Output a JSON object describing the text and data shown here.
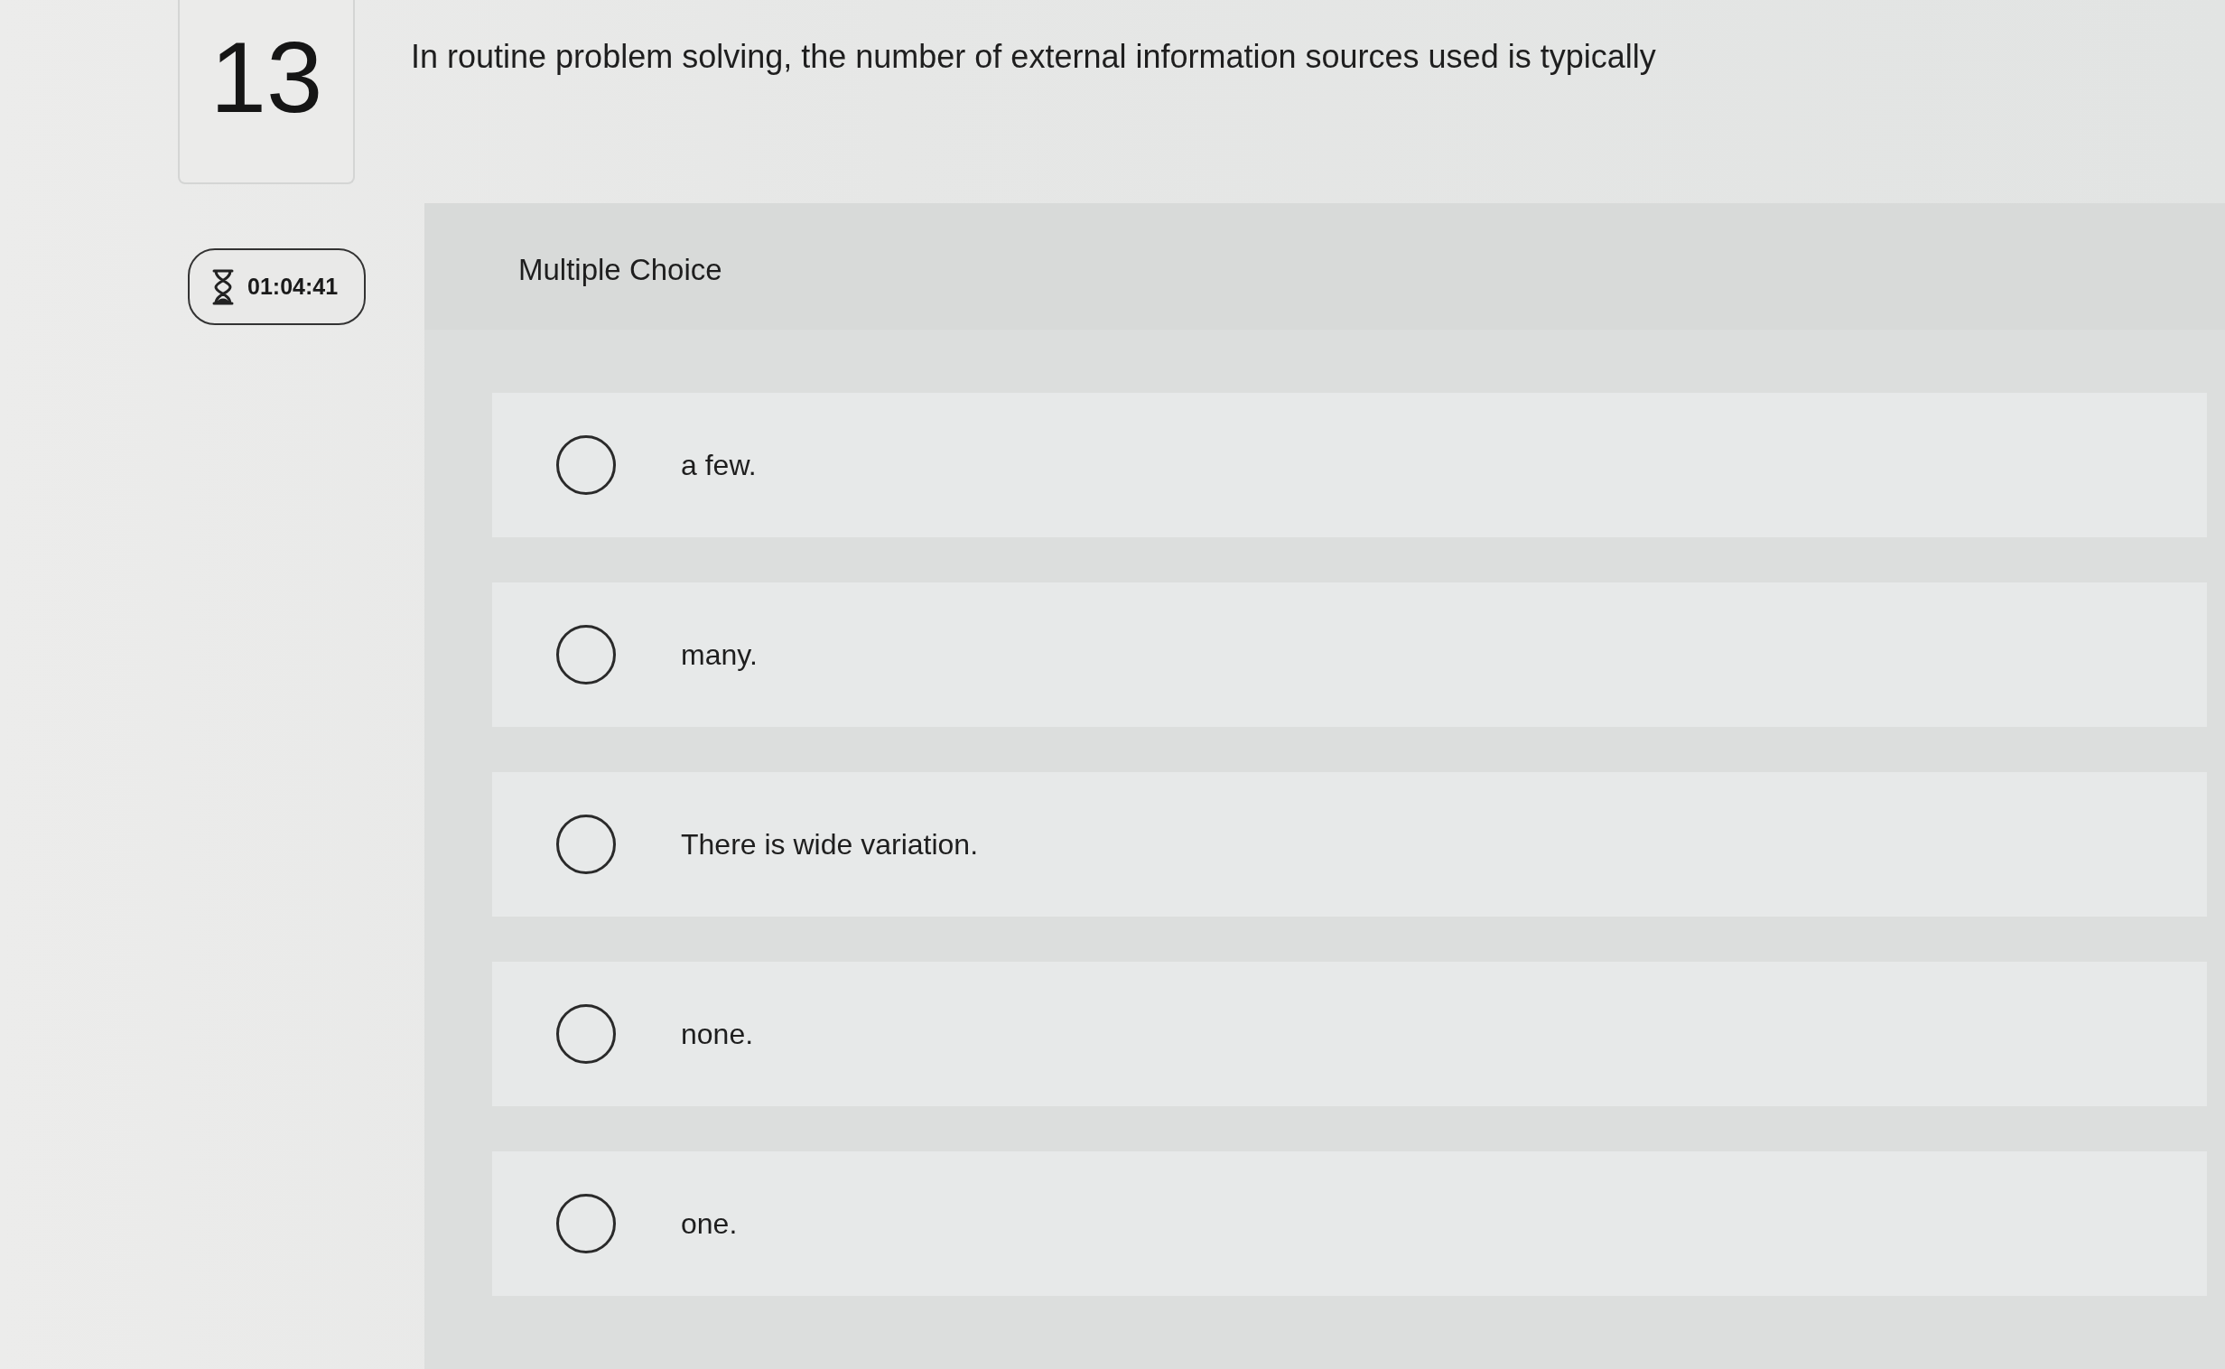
{
  "question": {
    "number": "13",
    "text": "In routine problem solving, the number of external information sources used is typically"
  },
  "timer": {
    "time": "01:04:41"
  },
  "answer_panel": {
    "type_label": "Multiple Choice",
    "options": [
      {
        "label": "a few.",
        "selected": false
      },
      {
        "label": "many.",
        "selected": false
      },
      {
        "label": "There is wide variation.",
        "selected": false
      },
      {
        "label": "none.",
        "selected": false
      },
      {
        "label": "one.",
        "selected": false
      }
    ]
  }
}
